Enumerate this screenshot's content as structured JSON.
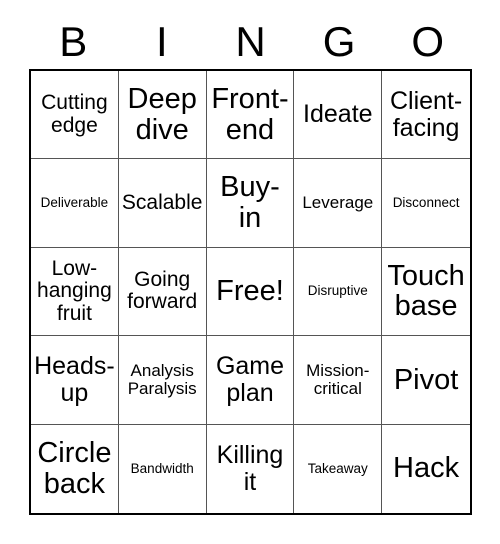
{
  "card": {
    "title": "BINGO",
    "header_letters": [
      "B",
      "I",
      "N",
      "G",
      "O"
    ],
    "free_space_label": "Free!",
    "colors": {
      "background": "#ffffff",
      "text": "#000000",
      "outer_border": "#000000",
      "inner_border": "#555555"
    },
    "grid": {
      "columns": 5,
      "rows": 5
    },
    "cells": [
      {
        "text": "Cutting edge",
        "size": "fs-md"
      },
      {
        "text": "Deep dive",
        "size": "fs-xl"
      },
      {
        "text": "Front-end",
        "size": "fs-xl"
      },
      {
        "text": "Ideate",
        "size": "fs-lg"
      },
      {
        "text": "Client-facing",
        "size": "fs-lg"
      },
      {
        "text": "Deliverable",
        "size": "fs-xs"
      },
      {
        "text": "Scalable",
        "size": "fs-md"
      },
      {
        "text": "Buy-in",
        "size": "fs-xl"
      },
      {
        "text": "Leverage",
        "size": "fs-sm"
      },
      {
        "text": "Disconnect",
        "size": "fs-xs"
      },
      {
        "text": "Low-hanging fruit",
        "size": "fs-md"
      },
      {
        "text": "Going forward",
        "size": "fs-md"
      },
      {
        "text": "Free!",
        "size": "fs-xl"
      },
      {
        "text": "Disruptive",
        "size": "fs-xs"
      },
      {
        "text": "Touch base",
        "size": "fs-xl"
      },
      {
        "text": "Heads-up",
        "size": "fs-lg"
      },
      {
        "text": "Analysis Paralysis",
        "size": "fs-sm"
      },
      {
        "text": "Game plan",
        "size": "fs-lg"
      },
      {
        "text": "Mission-critical",
        "size": "fs-sm"
      },
      {
        "text": "Pivot",
        "size": "fs-xl"
      },
      {
        "text": "Circle back",
        "size": "fs-xl"
      },
      {
        "text": "Bandwidth",
        "size": "fs-xs"
      },
      {
        "text": "Killing it",
        "size": "fs-lg"
      },
      {
        "text": "Takeaway",
        "size": "fs-xs"
      },
      {
        "text": "Hack",
        "size": "fs-xl"
      }
    ]
  }
}
